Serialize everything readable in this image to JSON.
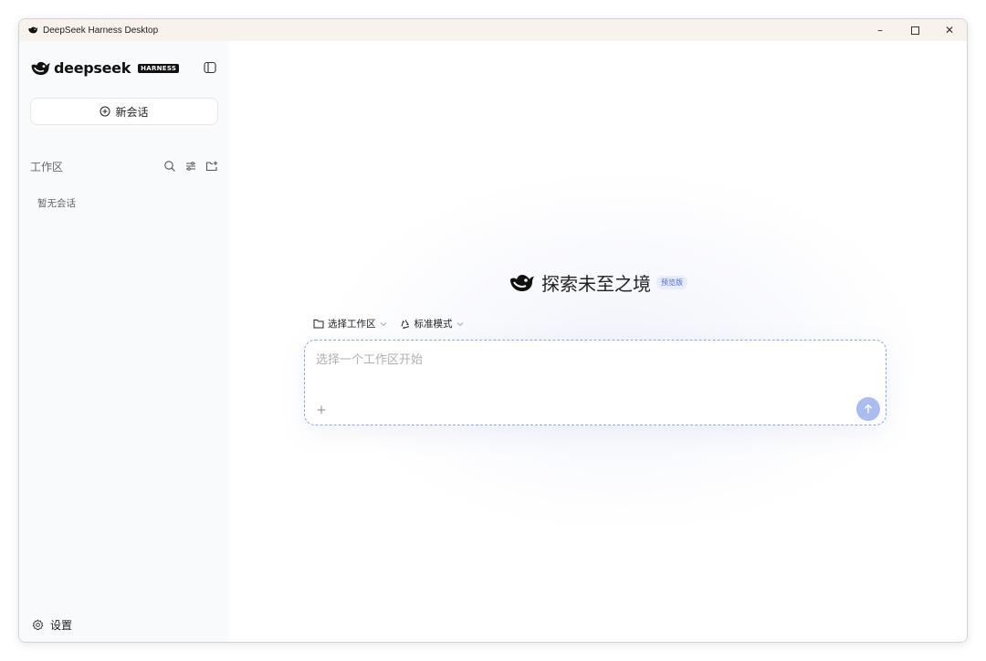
{
  "window": {
    "title": "DeepSeek Harness Desktop",
    "controls": {
      "minimize": "–",
      "maximize": "☐",
      "close": "✕"
    }
  },
  "sidebar": {
    "brand": "deepseek",
    "brand_badge": "HARNESS",
    "new_chat_label": "新会话",
    "workspace_label": "工作区",
    "empty_label": "暂无会话",
    "settings_label": "设置"
  },
  "main": {
    "hero_title": "探索未至之境",
    "preview_badge": "预览版",
    "workspace_selector": "选择工作区",
    "mode_selector": "标准模式",
    "composer": {
      "placeholder": "选择一个工作区开始",
      "value": ""
    }
  },
  "colors": {
    "accent": "#4d6bfe",
    "send_button": "#a9bdf1",
    "titlebar": "#f7f2ec",
    "sidebar": "#f9fafb"
  },
  "icons": {
    "app": "whale-icon",
    "sidebar_toggle": "sidebar-panel-icon",
    "new_chat": "plus-circle-icon",
    "search": "search-icon",
    "filter": "sliders-icon",
    "new_folder": "folder-plus-icon",
    "settings": "gear-icon",
    "folder": "folder-icon",
    "mode": "recycle-icon",
    "add": "plus-icon",
    "send": "arrow-up-icon"
  }
}
